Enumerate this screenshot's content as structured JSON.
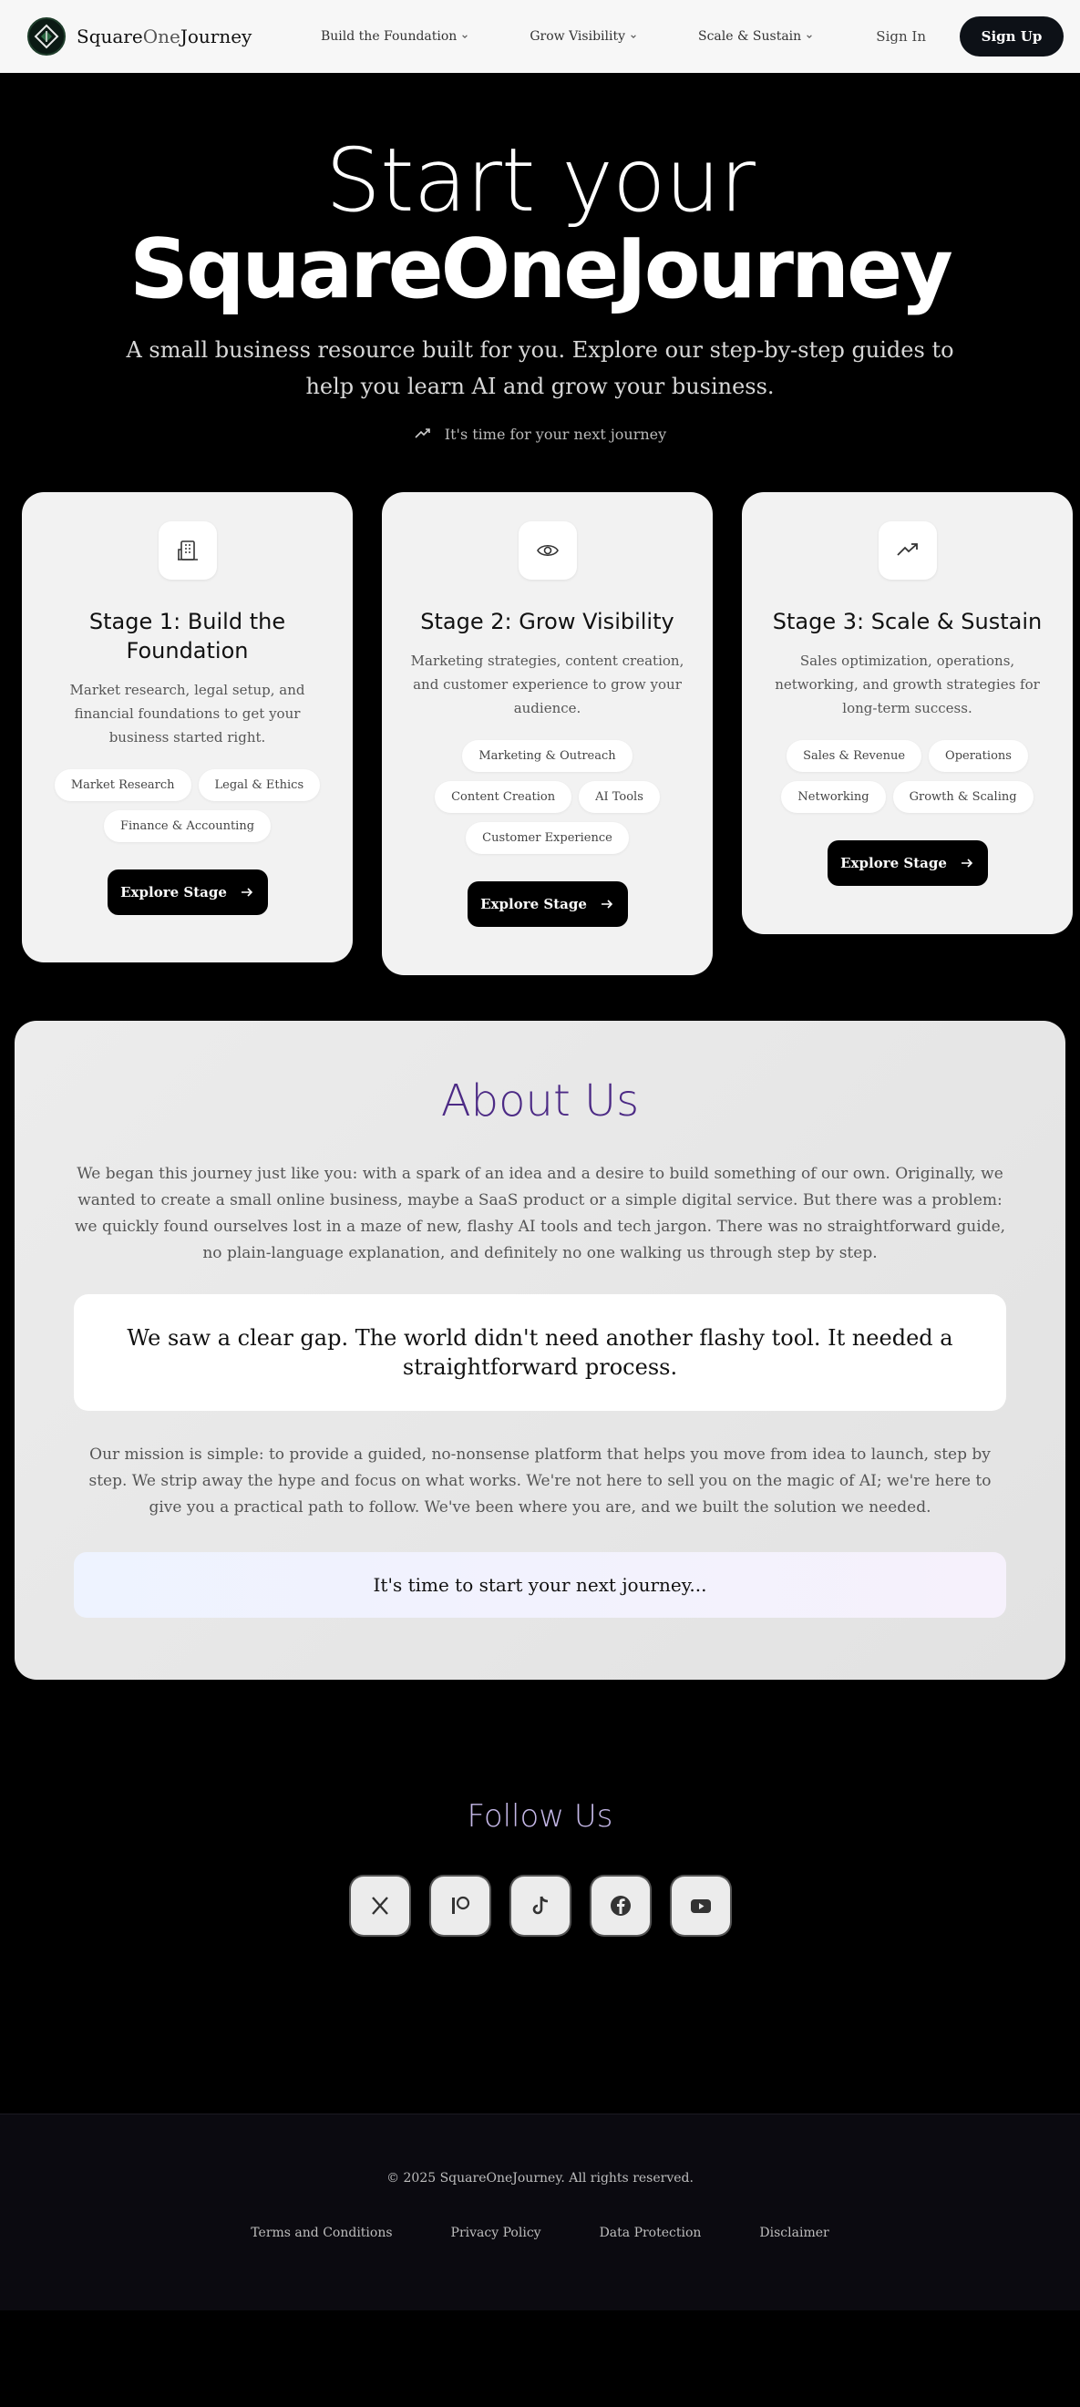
{
  "nav": {
    "brand": {
      "part1": "Square",
      "part2": "One",
      "part3": "Journey"
    },
    "links": [
      {
        "label": "Build the Foundation"
      },
      {
        "label": "Grow Visibility"
      },
      {
        "label": "Scale & Sustain"
      }
    ],
    "sign_in": "Sign In",
    "sign_up": "Sign Up"
  },
  "hero": {
    "line1": "Start your",
    "line2": "SquareOneJourney",
    "subtitle": "A small business resource built for you. Explore our step-by-step guides to help you learn AI and grow your business.",
    "tagline": "It's time for your next journey",
    "tagline_icon": "trending-up-icon"
  },
  "stages": [
    {
      "icon": "building-icon",
      "title": "Stage 1: Build the Foundation",
      "description": "Market research, legal setup, and financial foundations to get your business started right.",
      "tags": [
        "Market Research",
        "Legal & Ethics",
        "Finance & Accounting"
      ],
      "button": "Explore Stage"
    },
    {
      "icon": "eye-icon",
      "title": "Stage 2: Grow Visibility",
      "description": "Marketing strategies, content creation, and customer experience to grow your audience.",
      "tags": [
        "Marketing & Outreach",
        "Content Creation",
        "AI Tools",
        "Customer Experience"
      ],
      "button": "Explore Stage"
    },
    {
      "icon": "trending-up-icon",
      "title": "Stage 3: Scale & Sustain",
      "description": "Sales optimization, operations, networking, and growth strategies for long-term success.",
      "tags": [
        "Sales & Revenue",
        "Operations",
        "Networking",
        "Growth & Scaling"
      ],
      "button": "Explore Stage"
    }
  ],
  "about": {
    "title": "About Us",
    "paragraph1": "We began this journey just like you: with a spark of an idea and a desire to build something of our own. Originally, we wanted to create a small online business, maybe a SaaS product or a simple digital service. But there was a problem: we quickly found ourselves lost in a maze of new, flashy AI tools and tech jargon. There was no straightforward guide, no plain-language explanation, and definitely no one walking us through step by step.",
    "quote": "We saw a clear gap. The world didn't need another flashy tool. It needed a straightforward process.",
    "paragraph2": "Our mission is simple: to provide a guided, no-nonsense platform that helps you move from idea to launch, step by step. We strip away the hype and focus on what works. We're not here to sell you on the magic of AI; we're here to give you a practical path to follow. We've been where you are, and we built the solution we needed.",
    "cta": "It's time to start your next journey..."
  },
  "follow": {
    "title": "Follow Us",
    "socials": [
      "x-icon",
      "patreon-icon",
      "tiktok-icon",
      "facebook-icon",
      "youtube-icon"
    ]
  },
  "footer": {
    "copyright": "© 2025 SquareOneJourney. All rights reserved.",
    "links": [
      "Terms and Conditions",
      "Privacy Policy",
      "Data Protection",
      "Disclaimer"
    ]
  },
  "colors": {
    "about_title": "#4c2a85",
    "card_bg": "#f2f2f2",
    "follow_title": "#c5b8e8"
  }
}
